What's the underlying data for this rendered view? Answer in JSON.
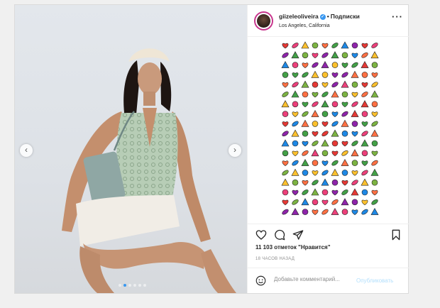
{
  "post": {
    "username": "giizeleoliveira",
    "separator": "•",
    "follow_label": "Подписки",
    "location": "Los Angeles, California",
    "more_label": "···",
    "likes_text": "11 103 отметок \"Нравится\"",
    "time_text": "18 ЧАСОВ НАЗАД",
    "comment_placeholder": "Добавьте комментарий...",
    "publish_label": "Опубликовать",
    "slides_total": 6,
    "slide_active": 2
  },
  "icons": [
    "heart-icon",
    "comment-icon",
    "share-icon",
    "bookmark-icon",
    "smile-icon",
    "verified-icon",
    "chevron-left-icon",
    "chevron-right-icon",
    "more-icon"
  ],
  "colors": {
    "accent": "#3897f0",
    "publish_disabled": "#b2dffc"
  }
}
